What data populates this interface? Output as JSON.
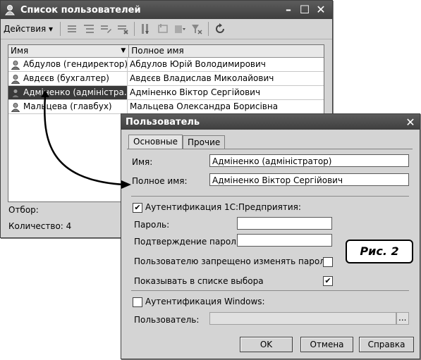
{
  "list_window": {
    "title": "Список пользователей",
    "actions_label": "Действия",
    "columns": [
      "Имя",
      "Полное имя"
    ],
    "rows": [
      {
        "name": "Абдулов (гендиректор)",
        "full_name": "Абдулов Юрій Володимирович",
        "selected": false
      },
      {
        "name": "Авдєєв (бухгалтер)",
        "full_name": "Авдєєв Владислав Миколайович",
        "selected": false
      },
      {
        "name": "Адміненко (адміністра...",
        "full_name": "Адміненко Віктор Сергійович",
        "selected": true
      },
      {
        "name": "Мальцева (главбух)",
        "full_name": "Мальцева Олександра Борисівна",
        "selected": false
      }
    ],
    "filter_label": "Отбор:",
    "count_label": "Количество: 4"
  },
  "dialog": {
    "title": "Пользователь",
    "tabs": [
      "Основные",
      "Прочие"
    ],
    "name_label": "Имя:",
    "name_value": "Адміненко (адміністратор)",
    "fullname_label": "Полное имя:",
    "fullname_value": "Адміненко Віктор Сергійович",
    "auth1c_label": "Аутентификация 1С:Предприятия:",
    "auth1c_checked": true,
    "password_label": "Пароль:",
    "password_value": "",
    "confirm_label": "Подтверждение пароля:",
    "confirm_value": "",
    "deny_change_label": "Пользователю запрещено изменять пароль",
    "deny_change_checked": false,
    "show_in_list_label": "Показывать в списке выбора",
    "show_in_list_checked": true,
    "auth_windows_label": "Аутентификация Windows:",
    "auth_windows_checked": false,
    "win_user_label": "Пользователь:",
    "win_user_value": "",
    "ellipsis": "...",
    "ok_label": "OK",
    "cancel_label": "Отмена",
    "help_label": "Справка"
  },
  "figure_label": "Рис. 2",
  "check_mark": "✔"
}
